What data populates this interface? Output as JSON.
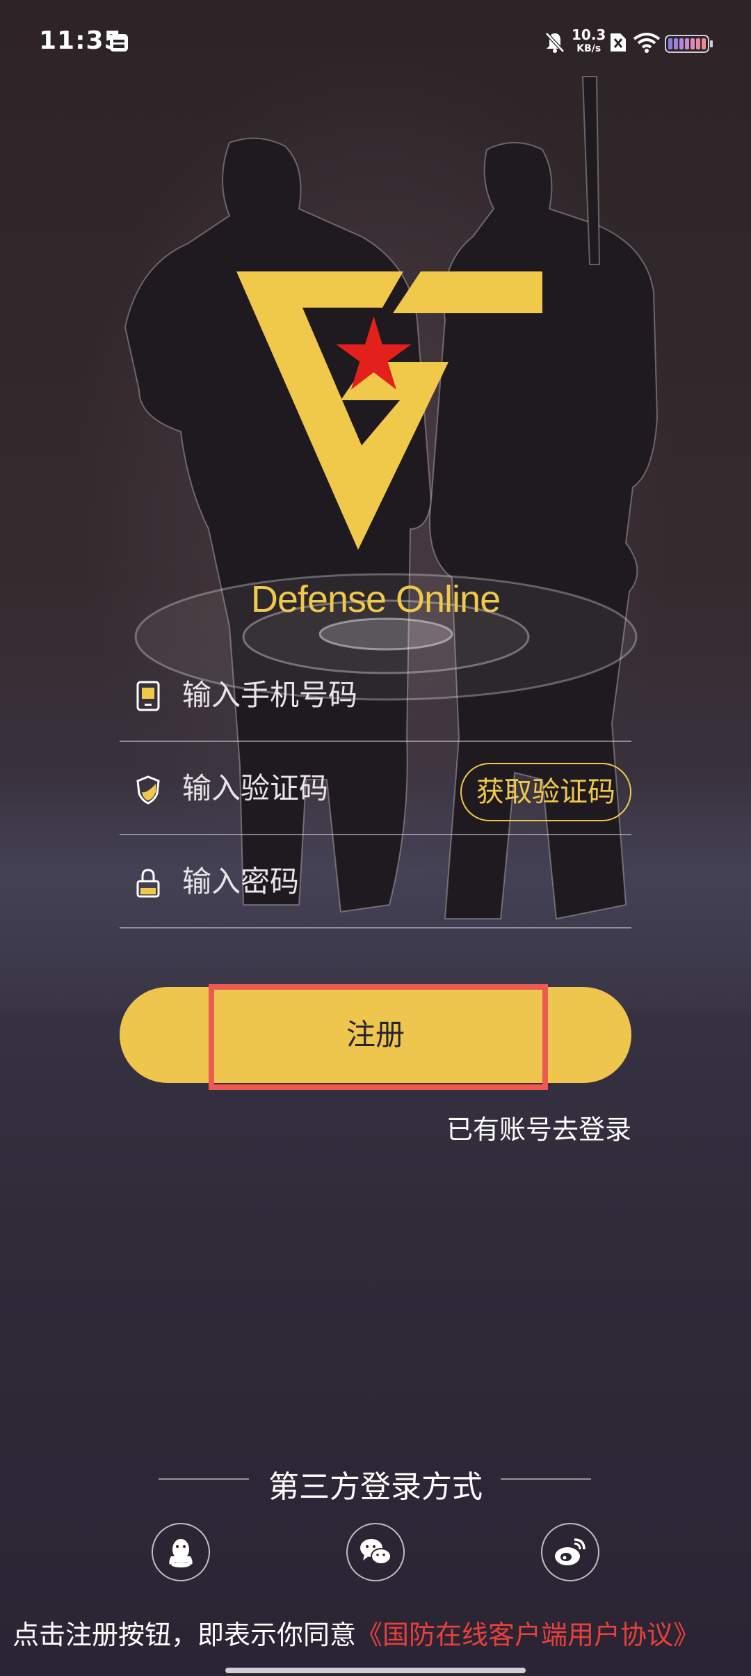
{
  "status_bar": {
    "time": "11:35",
    "net_speed_value": "10.3",
    "net_speed_unit": "KB/s",
    "icons": [
      "calendar-icon",
      "mute-bell-icon",
      "sim-x-icon",
      "wifi-icon",
      "battery-icon"
    ]
  },
  "brand": {
    "name": "Defense Online",
    "logo_colors": {
      "primary": "#f0c94a",
      "star": "#e4201c"
    }
  },
  "form": {
    "phone": {
      "placeholder": "输入手机号码",
      "value": "",
      "icon": "phone-icon"
    },
    "code": {
      "placeholder": "输入验证码",
      "value": "",
      "icon": "shield-icon",
      "get_code_label": "获取验证码"
    },
    "password": {
      "placeholder": "输入密码",
      "value": "",
      "icon": "lock-icon"
    },
    "register_label": "注册",
    "login_link": "已有账号去登录"
  },
  "third_party": {
    "title": "第三方登录方式",
    "providers": [
      "qq-icon",
      "wechat-icon",
      "weibo-icon"
    ]
  },
  "agreement": {
    "prefix": "点击注册按钮，即表示你同意",
    "link": "《国防在线客户端用户协议》"
  },
  "colors": {
    "accent": "#eec64e",
    "highlight_box": "#ec5a52",
    "link_red": "#e8403a"
  }
}
